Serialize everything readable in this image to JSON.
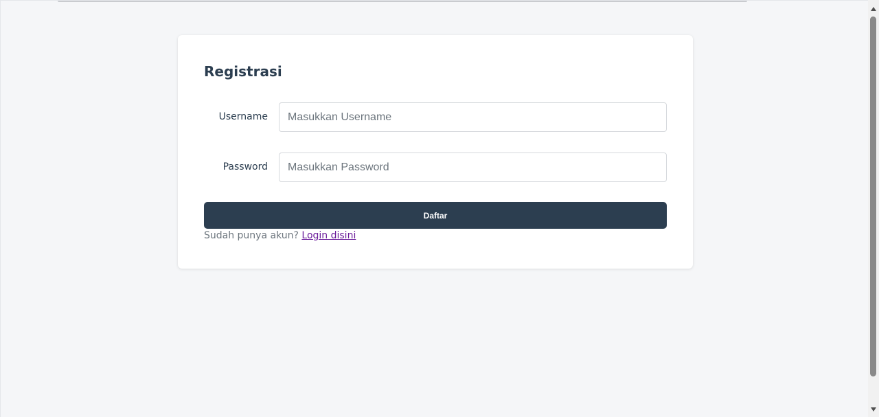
{
  "form": {
    "title": "Registrasi",
    "username_label": "Username",
    "username_placeholder": "Masukkan Username",
    "username_value": "",
    "password_label": "Password",
    "password_placeholder": "Masukkan Password",
    "password_value": "",
    "submit_label": "Daftar",
    "footer_prompt": "Sudah punya akun?",
    "login_link_label": "Login disini"
  },
  "colors": {
    "primary": "#2c3e50",
    "page_background": "#f5f6f8",
    "link_visited": "#6a1b9a"
  }
}
